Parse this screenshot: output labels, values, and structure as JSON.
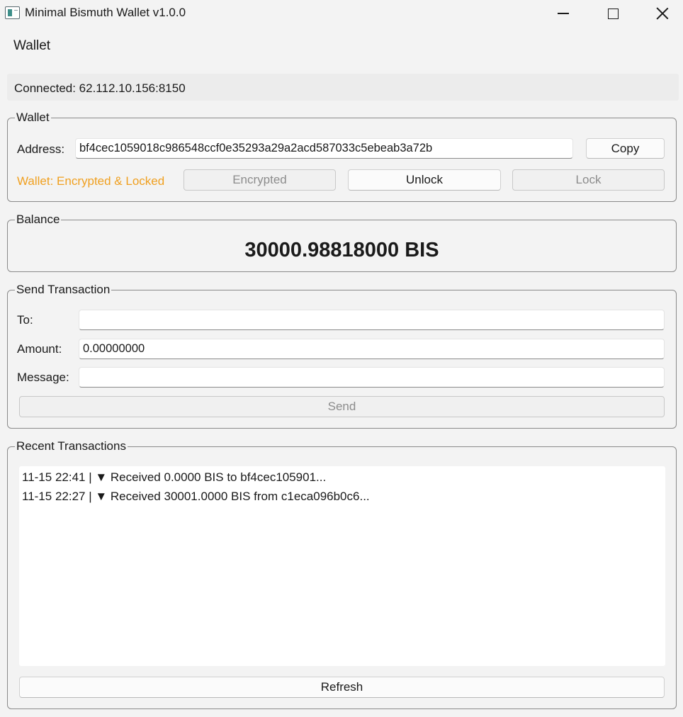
{
  "window": {
    "title": "Minimal Bismuth Wallet v1.0.0"
  },
  "header": {
    "title": "Wallet"
  },
  "status": {
    "text": "Connected: 62.112.10.156:8150"
  },
  "wallet": {
    "group_title": "Wallet",
    "address_label": "Address:",
    "address_value": "bf4cec1059018c986548ccf0e35293a29a2acd587033c5ebeab3a72b",
    "copy_label": "Copy",
    "state_label": "Wallet: Encrypted & Locked",
    "state_color": "#f0a020",
    "encrypted_label": "Encrypted",
    "unlock_label": "Unlock",
    "lock_label": "Lock"
  },
  "balance": {
    "group_title": "Balance",
    "value": "30000.98818000 BIS"
  },
  "send": {
    "group_title": "Send Transaction",
    "to_label": "To:",
    "to_value": "",
    "amount_label": "Amount:",
    "amount_value": "0.00000000",
    "message_label": "Message:",
    "message_value": "",
    "send_label": "Send"
  },
  "transactions": {
    "group_title": "Recent Transactions",
    "items": [
      "11-15 22:41 | ▼ Received 0.0000 BIS to bf4cec105901...",
      "11-15 22:27 | ▼ Received 30001.0000 BIS from c1eca096b0c6..."
    ],
    "refresh_label": "Refresh"
  }
}
